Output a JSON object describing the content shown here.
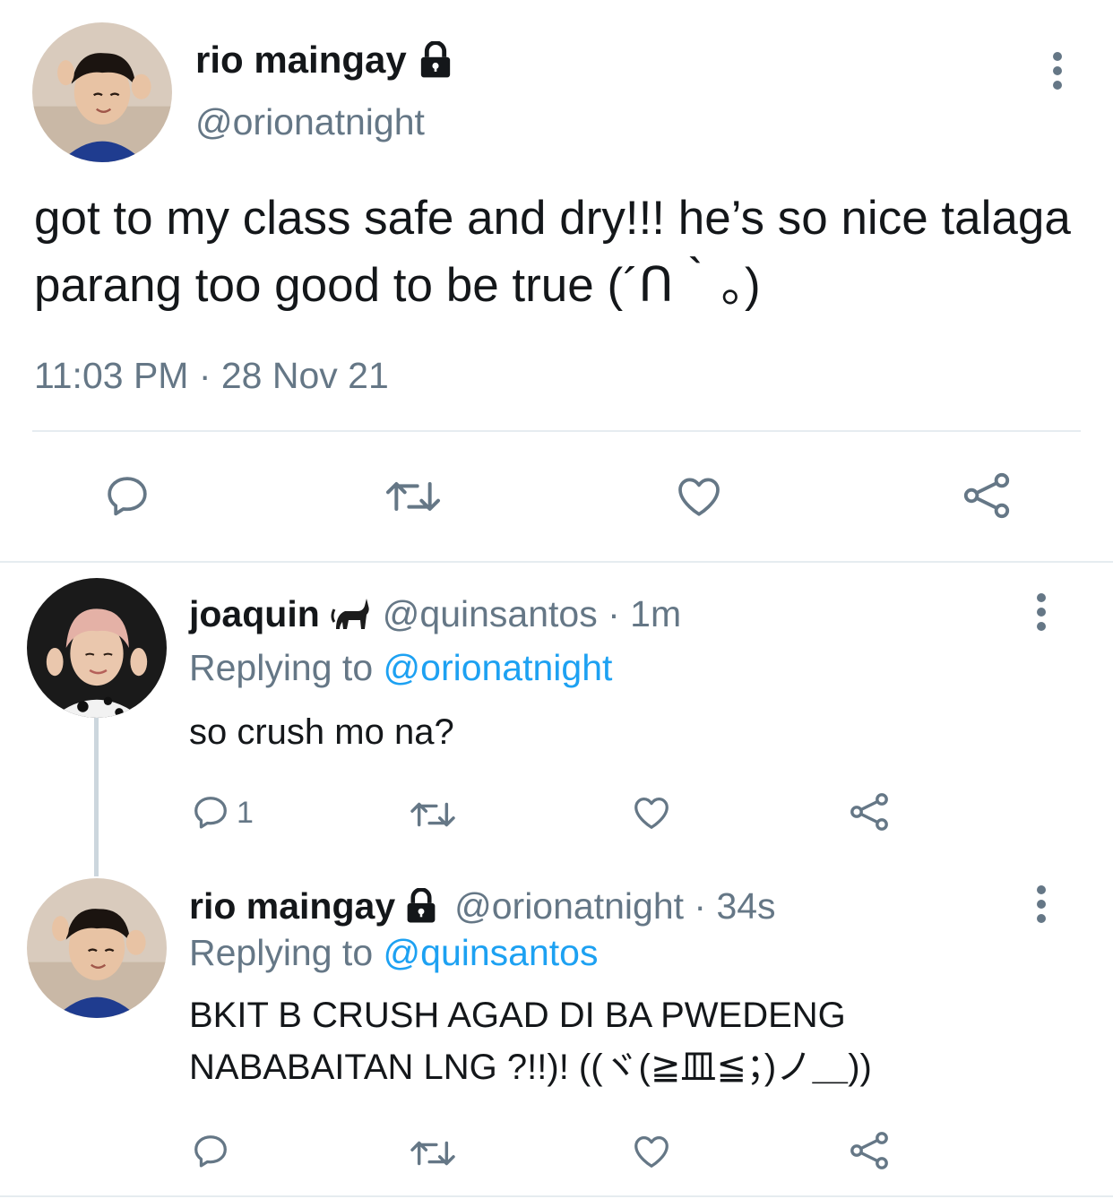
{
  "main_tweet": {
    "display_name": "rio maingay",
    "handle": "@orionatnight",
    "text": "got to my class safe and dry!!! he’s so nice talaga parang too good to be true (´ᑎ｀。)",
    "timestamp": "11:03 PM · 28 Nov 21",
    "actions": [
      "reply-icon",
      "retweet-icon",
      "like-icon",
      "share-icon"
    ]
  },
  "replies": [
    {
      "display_name": "joaquin",
      "name_emoji": "🐈‍⬛",
      "meta": "@quinsantos · 1m",
      "replying_prefix": "Replying to ",
      "replying_to": "@orionatnight",
      "text": "so crush mo na?",
      "reply_count": "1"
    },
    {
      "display_name": "rio maingay",
      "meta": "@orionatnight · 34s",
      "replying_prefix": "Replying to ",
      "replying_to": "@quinsantos",
      "text": "BKIT B CRUSH AGAD DI BA PWEDENG NABABAITAN LNG ?!!)! ((ヾ(≧皿≦；)ノ＿))",
      "reply_count": ""
    }
  ],
  "colors": {
    "text": "#14171a",
    "secondary": "#657786",
    "link": "#1da1f2",
    "divider": "#e6ecf0"
  }
}
